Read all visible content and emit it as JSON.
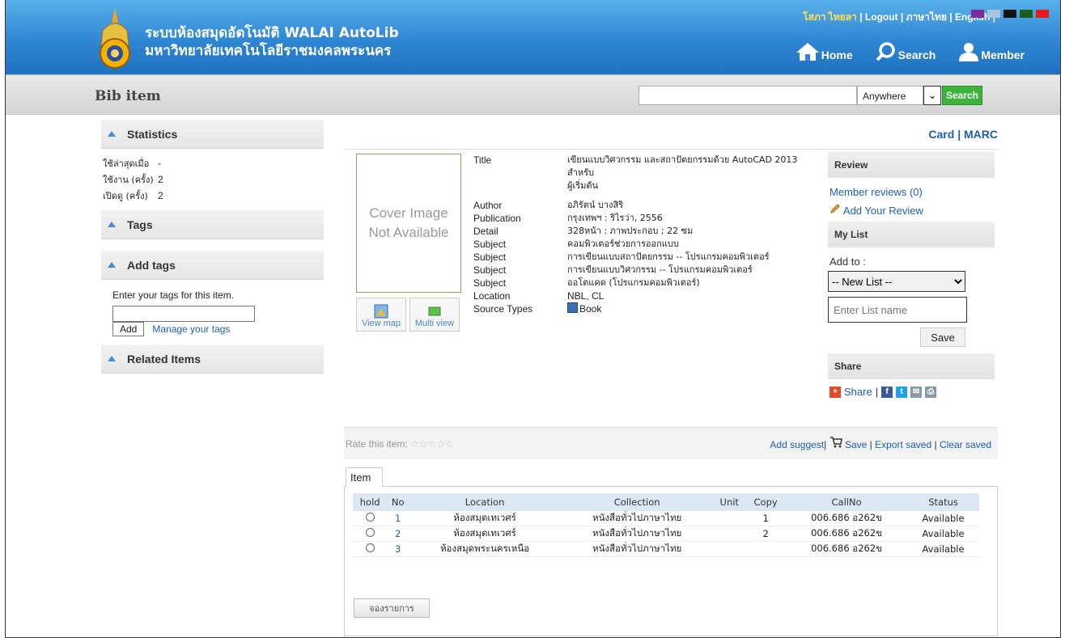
{
  "header": {
    "title_line1": "ระบบห้องสมุดอัตโนมัติ WALAI AutoLib",
    "title_line2": "มหาวิทยาลัยเทคโนโลยีราชมงคลพระนคร",
    "user": "โสภา ไทยลา",
    "logout": "Logout",
    "lang_th": "ภาษาไทย",
    "lang_en": "English",
    "nav": {
      "home": "Home",
      "search": "Search",
      "member": "Member"
    },
    "theme_colors": [
      "#7b2b9e",
      "#a9c6dc",
      "#111111",
      "#1b5e20",
      "#e21b1b"
    ]
  },
  "searchbar": {
    "page_title": "Bib item",
    "query": "",
    "scope": "Anywhere",
    "button": "Search"
  },
  "sidebar": {
    "statistics": {
      "heading": "Statistics",
      "rows": [
        {
          "label": "ใช้ล่าสุดเมื่อ",
          "value": "-"
        },
        {
          "label": "ใช้งาน (ครั้ง)",
          "value": "2"
        },
        {
          "label": "เปิดดู (ครั้ง)",
          "value": "2"
        }
      ]
    },
    "tags_heading": "Tags",
    "addtags": {
      "heading": "Add tags",
      "prompt": "Enter your tags for this item.",
      "add_button": "Add",
      "manage_link": "Manage your tags"
    },
    "related_heading": "Related Items"
  },
  "main": {
    "card": "Card",
    "marc": "MARC",
    "cover_line1": "Cover Image",
    "cover_line2": "Not Available",
    "view_map": "View map",
    "multi_view": "Multi view",
    "meta": {
      "title_k": "Title",
      "title_v1": "เขียนแบบวิศวกรรม และสถาปัตยกรรมด้วย AutoCAD 2013 สำหรับ",
      "title_v2": "ผู้เริ่มต้น",
      "author_k": "Author",
      "author_v": "อภิรัตน์ บางสิริ",
      "pub_k": "Publication",
      "pub_v": "กรุงเทพฯ : ริไรว่า, 2556",
      "detail_k": "Detail",
      "detail_v": "328หน้า : ภาพประกอบ ; 22 ซม",
      "subjects": [
        {
          "k": "Subject",
          "v": "คอมพิวเตอร์ช่วยการออกแบบ"
        },
        {
          "k": "Subject",
          "v": "การเขียนแบบสถาปัตยกรรม -- โปรแกรมคอมพิวเตอร์"
        },
        {
          "k": "Subject",
          "v": "การเขียนแบบวิศวกรรม -- โปรแกรมคอมพิวเตอร์"
        },
        {
          "k": "Subject",
          "v": "ออโตแคด (โปรแกรมคอมพิวเตอร์)"
        }
      ],
      "location_k": "Location",
      "location_v": "NBL, CL",
      "source_k": "Source Types",
      "source_v": "Book"
    },
    "review": {
      "heading": "Review",
      "member_reviews": "Member reviews (0)",
      "add_review": "Add Your Review"
    },
    "mylist": {
      "heading": "My List",
      "add_to": "Add to :",
      "selected": "-- New List --",
      "placeholder": "Enter List name",
      "save": "Save"
    },
    "share": {
      "heading": "Share",
      "label": "Share"
    },
    "rate": {
      "label": "Rate this item:",
      "stars": "☆☆☆☆☆",
      "add_suggest": "Add suggest",
      "save": "Save",
      "export": "Export saved",
      "clear": "Clear saved"
    },
    "items": {
      "tab": "Item",
      "columns": [
        "hold",
        "No",
        "Location",
        "Collection",
        "Unit",
        "Copy",
        "CallNo",
        "Status"
      ],
      "rows": [
        {
          "no": "1",
          "location": "ห้องสมุดเทเวศร์",
          "collection": "หนังสือทั่วไปภาษาไทย",
          "unit": "",
          "copy": "1",
          "callno": "006.686 อ262ข",
          "status": "Available"
        },
        {
          "no": "2",
          "location": "ห้องสมุดเทเวศร์",
          "collection": "หนังสือทั่วไปภาษาไทย",
          "unit": "",
          "copy": "2",
          "callno": "006.686 อ262ข",
          "status": "Available"
        },
        {
          "no": "3",
          "location": "ห้องสมุดพระนครเหนือ",
          "collection": "หนังสือทั่วไปภาษาไทย",
          "unit": "",
          "copy": "",
          "callno": "006.686 อ262ข",
          "status": "Available"
        }
      ],
      "reserve_button": "จองรายการ"
    }
  }
}
